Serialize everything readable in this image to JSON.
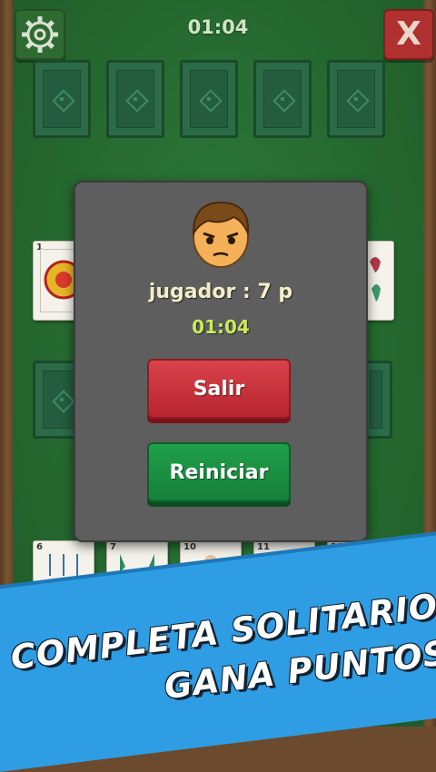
{
  "header": {
    "timer": "01:04",
    "close_label": "X"
  },
  "board": {
    "foundation_slots": 5,
    "tableau_cards": [
      {
        "number": "1",
        "suit": "oros"
      },
      {
        "number": "6",
        "suit": "espadas"
      },
      {
        "number": "7",
        "suit": "bastos"
      },
      {
        "number": "10",
        "suit": "oros"
      },
      {
        "number": "11",
        "suit": "copas"
      },
      {
        "number": "12",
        "suit": "copas"
      }
    ]
  },
  "modal": {
    "player_score": "jugador : 7 p",
    "time": "01:04",
    "exit_label": "Salir",
    "restart_label": "Reiniciar"
  },
  "promo": {
    "line1": "COMPLETA SOLITARIOS Y",
    "line2": "GANA PUNTOS!"
  },
  "colors": {
    "felt": "#25682f",
    "exit_button": "#c92f38",
    "restart_button": "#1a8f42",
    "banner": "#2f9de3",
    "timer_highlight": "#cde85a"
  }
}
